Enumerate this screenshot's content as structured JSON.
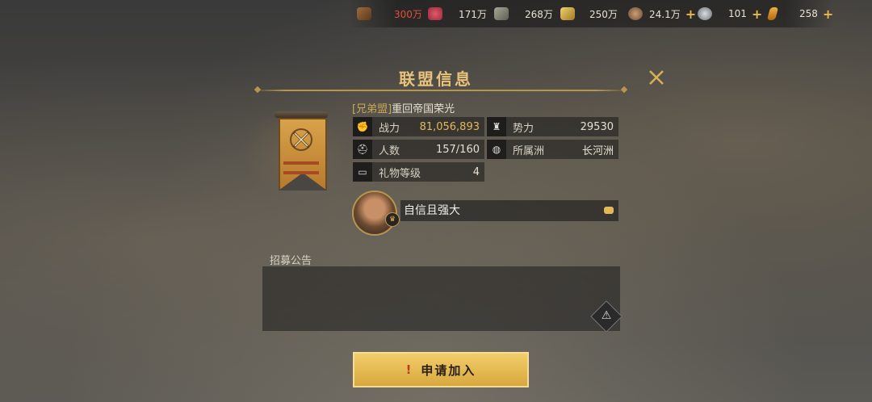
{
  "resources": [
    {
      "icon": "wood-log-icon",
      "value": "300万",
      "color": "#e0503c"
    },
    {
      "icon": "meat-icon",
      "value": "171万",
      "color": "#e8e2d2"
    },
    {
      "icon": "stone-icon",
      "value": "268万",
      "color": "#e8e2d2"
    },
    {
      "icon": "gold-bar-icon",
      "value": "250万",
      "color": "#e8e2d2"
    },
    {
      "icon": "coin-icon",
      "value": "24.1万",
      "color": "#e8e2d2",
      "plus": "+"
    },
    {
      "icon": "silver-coin-icon",
      "value": "101",
      "color": "#e8e2d2",
      "plus": "+"
    },
    {
      "icon": "crystal-icon",
      "value": "258",
      "color": "#e8e2d2",
      "plus": "+"
    }
  ],
  "dialog": {
    "title": "联盟信息",
    "close_icon": "close-icon"
  },
  "alliance": {
    "tag": "[兄弟盟]",
    "name": "重回帝国荣光",
    "stats": {
      "power": {
        "label": "战力",
        "value": "81,056,893"
      },
      "influence": {
        "label": "势力",
        "value": "29530"
      },
      "members": {
        "label": "人数",
        "value": "157/160"
      },
      "continent": {
        "label": "所属洲",
        "value": "长河洲"
      },
      "gift_level": {
        "label": "礼物等级",
        "value": "4"
      }
    },
    "motto": "自信且强大"
  },
  "announcement": {
    "label": "招募公告",
    "text": ""
  },
  "apply_button": {
    "mark": "!",
    "label": "申请加入"
  },
  "colors": {
    "accent": "#e8c27a",
    "gold_value": "#e2b85a",
    "warning_red": "#e0503c"
  }
}
